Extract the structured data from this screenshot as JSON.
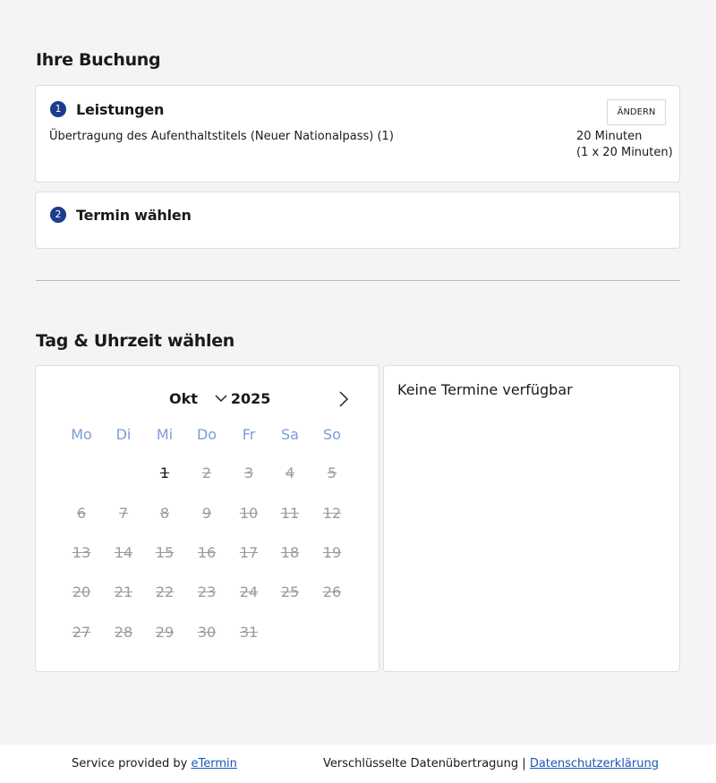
{
  "booking": {
    "title": "Ihre Buchung",
    "step1": {
      "number": "1",
      "title": "Leistungen",
      "change_label": "ÄNDERN",
      "service": "Übertragung des Aufenthaltstitels (Neuer Nationalpass) (1)",
      "duration": "20 Minuten",
      "duration_detail": "(1 x 20 Minuten)"
    },
    "step2": {
      "number": "2",
      "title": "Termin wählen"
    }
  },
  "schedule": {
    "title": "Tag & Uhrzeit wählen",
    "month": "Okt",
    "year": "2025",
    "weekdays": [
      "Mo",
      "Di",
      "Mi",
      "Do",
      "Fr",
      "Sa",
      "So"
    ],
    "days": [
      "1",
      "2",
      "3",
      "4",
      "5",
      "6",
      "7",
      "8",
      "9",
      "10",
      "11",
      "12",
      "13",
      "14",
      "15",
      "16",
      "17",
      "18",
      "19",
      "20",
      "21",
      "22",
      "23",
      "24",
      "25",
      "26",
      "27",
      "28",
      "29",
      "30",
      "31"
    ],
    "no_slots": "Keine Termine verfügbar"
  },
  "footer": {
    "provided_by": "Service provided by",
    "provider_link": "eTermin",
    "encryption": "Verschlüsselte Datenübertragung |",
    "privacy_link": "Datenschutzerklärung"
  },
  "colors": {
    "badge": "#1a3d8f",
    "weekday": "#7a9cd6",
    "link": "#1a56b8",
    "disabled_day": "#9b9b9b"
  }
}
